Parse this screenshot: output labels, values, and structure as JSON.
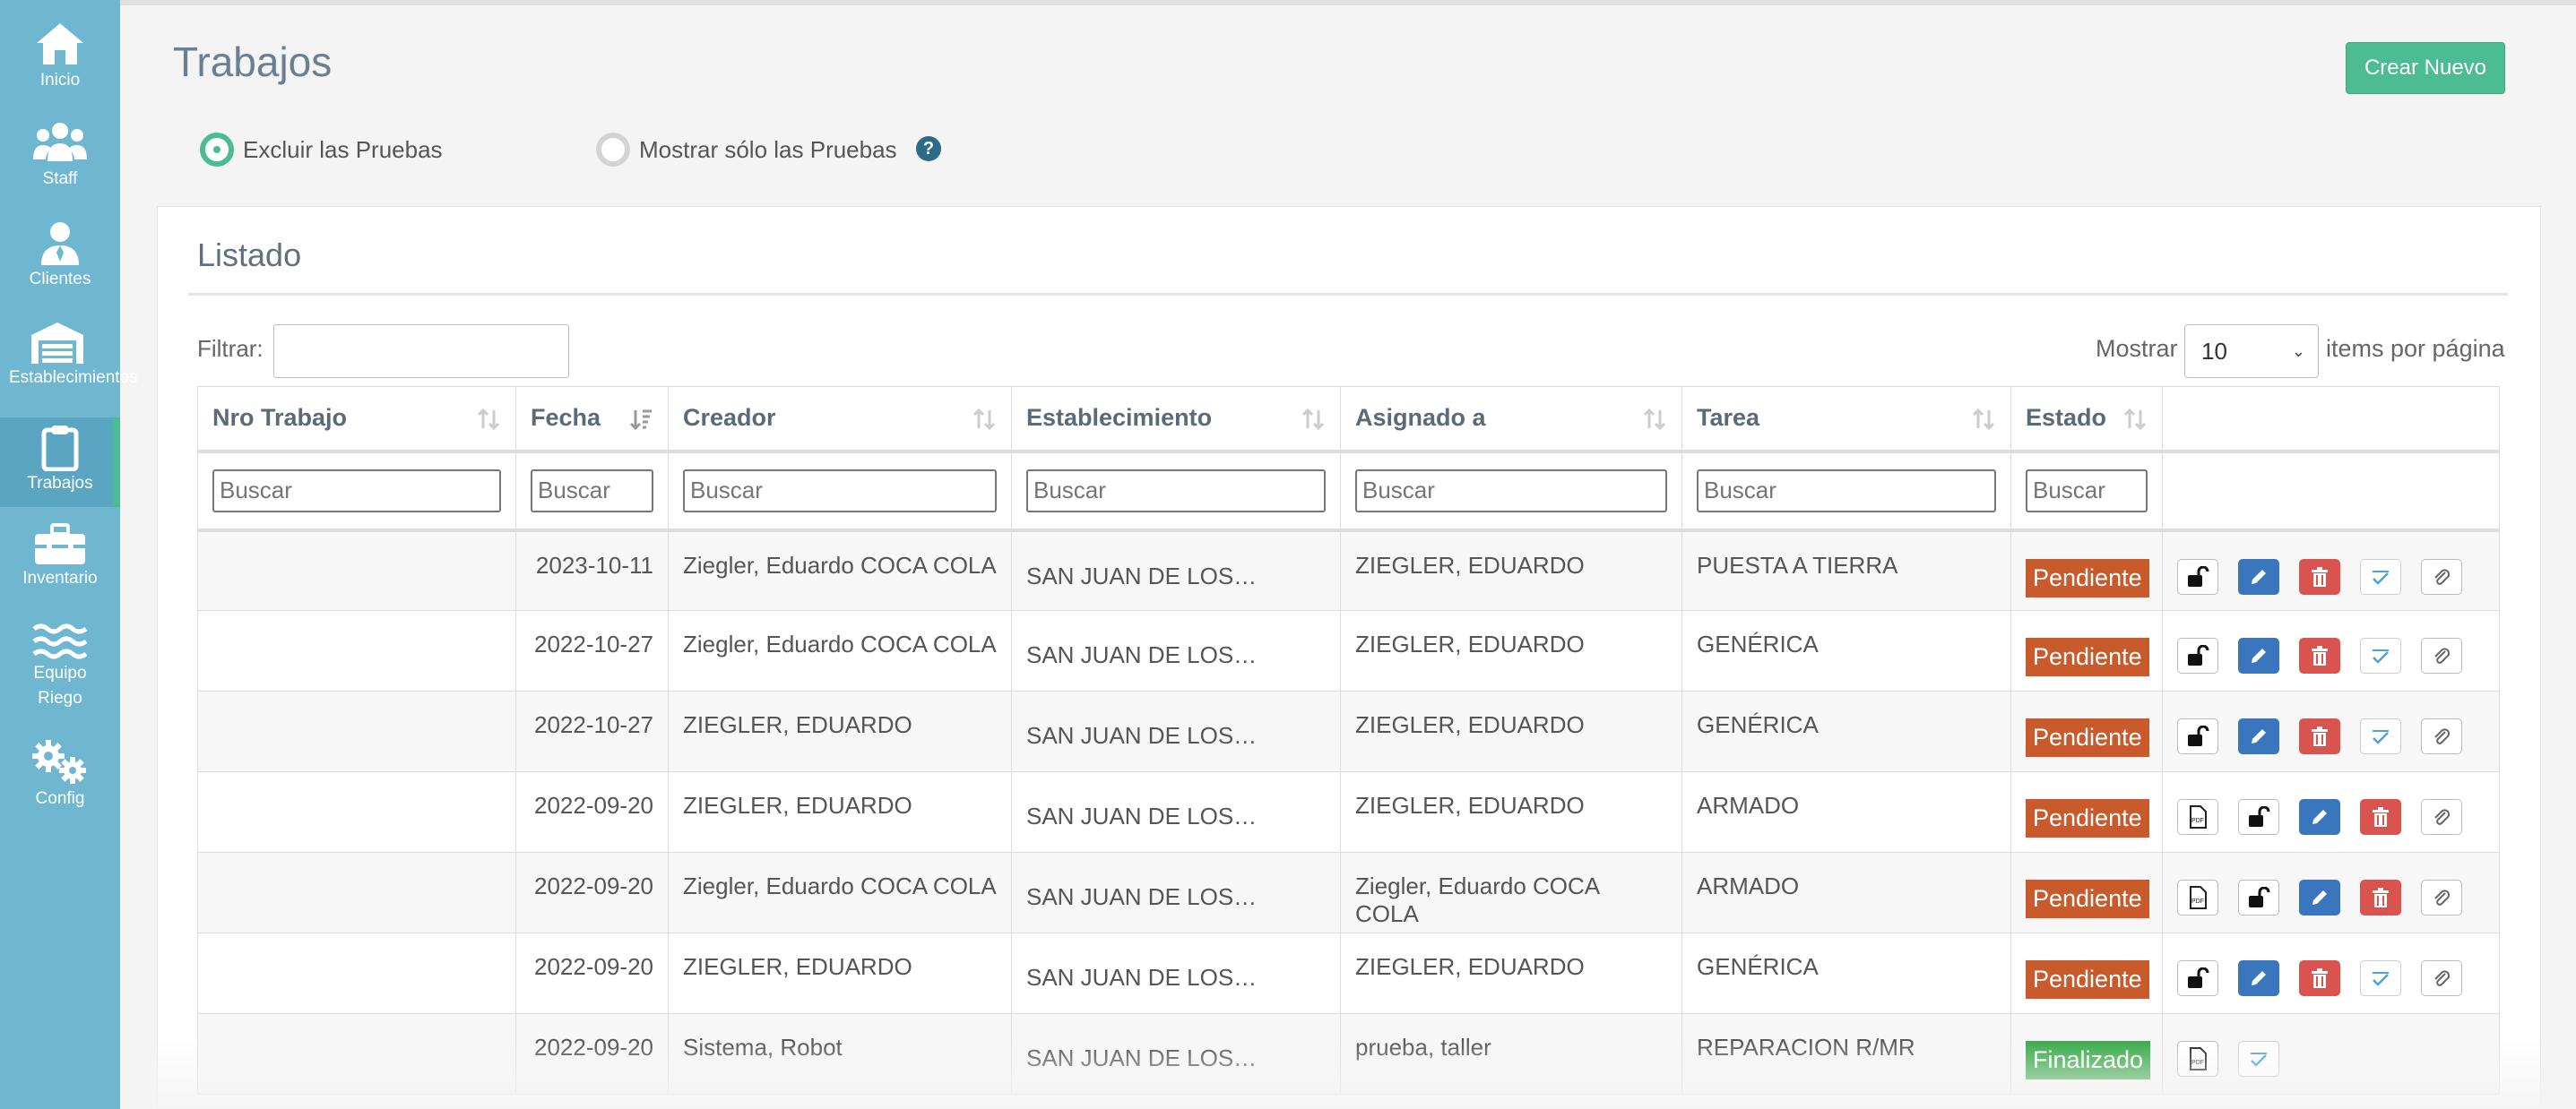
{
  "sidebar": {
    "items": [
      {
        "label": "Inicio",
        "icon": "home-icon"
      },
      {
        "label": "Staff",
        "icon": "users-icon"
      },
      {
        "label": "Clientes",
        "icon": "client-icon"
      },
      {
        "label": "Establecimientos",
        "icon": "warehouse-icon"
      },
      {
        "label": "Trabajos",
        "icon": "clipboard-icon",
        "active": true
      },
      {
        "label": "Inventario",
        "icon": "toolbox-icon"
      },
      {
        "label": "Equipo",
        "label2": "Riego",
        "icon": "water-icon"
      },
      {
        "label": "Config",
        "icon": "gears-icon"
      }
    ]
  },
  "header": {
    "title": "Trabajos",
    "new_button": "Crear Nuevo"
  },
  "filters": {
    "exclude_tests": "Excluir las Pruebas",
    "only_tests": "Mostrar sólo las Pruebas",
    "help": "?"
  },
  "panel": {
    "title": "Listado",
    "filter_label": "Filtrar:",
    "show_label": "Mostrar",
    "page_size": "10",
    "items_label": "items por página"
  },
  "table": {
    "columns": [
      "Nro Trabajo",
      "Fecha",
      "Creador",
      "Establecimiento",
      "Asignado a",
      "Tarea",
      "Estado"
    ],
    "search_placeholder": "Buscar",
    "rows": [
      {
        "nro": "",
        "fecha": "2023-10-11",
        "creador": "Ziegler, Eduardo COCA COLA",
        "establecimiento": "SAN JUAN DE LOS…",
        "asignado": "ZIEGLER, EDUARDO",
        "tarea": "PUESTA A TIERRA",
        "estado": "Pendiente",
        "status": "pend",
        "actions": [
          "lock",
          "edit",
          "del",
          "check",
          "clip"
        ]
      },
      {
        "nro": "",
        "fecha": "2022-10-27",
        "creador": "Ziegler, Eduardo COCA COLA",
        "establecimiento": "SAN JUAN DE LOS…",
        "asignado": "ZIEGLER, EDUARDO",
        "tarea": "GENÉRICA",
        "estado": "Pendiente",
        "status": "pend",
        "actions": [
          "lock",
          "edit",
          "del",
          "check",
          "clip"
        ]
      },
      {
        "nro": "",
        "fecha": "2022-10-27",
        "creador": "ZIEGLER, EDUARDO",
        "establecimiento": "SAN JUAN DE LOS…",
        "asignado": "ZIEGLER, EDUARDO",
        "tarea": "GENÉRICA",
        "estado": "Pendiente",
        "status": "pend",
        "actions": [
          "lock",
          "edit",
          "del",
          "check",
          "clip"
        ]
      },
      {
        "nro": "",
        "fecha": "2022-09-20",
        "creador": "ZIEGLER, EDUARDO",
        "establecimiento": "SAN JUAN DE LOS…",
        "asignado": "ZIEGLER, EDUARDO",
        "tarea": "ARMADO",
        "estado": "Pendiente",
        "status": "pend",
        "actions": [
          "pdf",
          "lock",
          "edit",
          "del",
          "clip"
        ]
      },
      {
        "nro": "",
        "fecha": "2022-09-20",
        "creador": "Ziegler, Eduardo COCA COLA",
        "establecimiento": "SAN JUAN DE LOS…",
        "asignado": "Ziegler, Eduardo COCA COLA",
        "tarea": "ARMADO",
        "estado": "Pendiente",
        "status": "pend",
        "actions": [
          "pdf",
          "lock",
          "edit",
          "del",
          "clip"
        ]
      },
      {
        "nro": "",
        "fecha": "2022-09-20",
        "creador": "ZIEGLER, EDUARDO",
        "establecimiento": "SAN JUAN DE LOS…",
        "asignado": "ZIEGLER, EDUARDO",
        "tarea": "GENÉRICA",
        "estado": "Pendiente",
        "status": "pend",
        "actions": [
          "lock",
          "edit",
          "del",
          "check",
          "clip"
        ]
      },
      {
        "nro": "",
        "fecha": "2022-09-20",
        "creador": "Sistema, Robot",
        "establecimiento": "SAN JUAN DE LOS…",
        "asignado": "prueba, taller",
        "tarea": "REPARACION R/MR",
        "estado": "Finalizado",
        "status": "fin",
        "actions": [
          "pdf",
          "check"
        ]
      }
    ]
  },
  "colors": {
    "sidebar": "#6fb7d1",
    "accent": "#4cbc93",
    "pending": "#c85a2c",
    "done": "#39a94a",
    "edit": "#3a76bd",
    "delete": "#d9534f"
  }
}
